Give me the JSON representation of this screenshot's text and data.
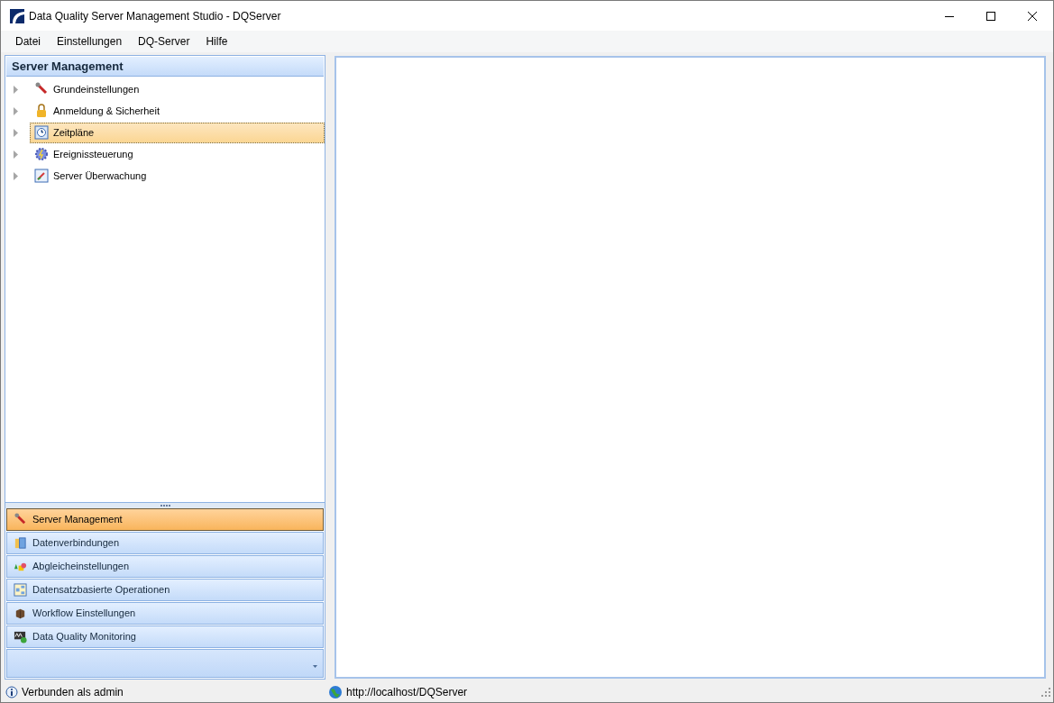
{
  "window": {
    "title": "Data Quality Server Management Studio - DQServer"
  },
  "menu": [
    "Datei",
    "Einstellungen",
    "DQ-Server",
    "Hilfe"
  ],
  "panel": {
    "title": "Server Management",
    "tree": [
      {
        "label": "Grundeinstellungen",
        "expanded": false,
        "selected": false
      },
      {
        "label": "Anmeldung & Sicherheit",
        "expanded": false,
        "selected": false
      },
      {
        "label": "Zeitpläne",
        "expanded": false,
        "selected": true
      },
      {
        "label": "Ereignissteuerung",
        "expanded": false,
        "selected": false
      },
      {
        "label": "Server Überwachung",
        "expanded": false,
        "selected": false
      }
    ]
  },
  "nav": [
    {
      "label": "Server Management",
      "selected": true
    },
    {
      "label": "Datenverbindungen",
      "selected": false
    },
    {
      "label": "Abgleicheinstellungen",
      "selected": false
    },
    {
      "label": "Datensatzbasierte Operationen",
      "selected": false
    },
    {
      "label": "Workflow Einstellungen",
      "selected": false
    },
    {
      "label": "Data Quality Monitoring",
      "selected": false
    }
  ],
  "status_bar": {
    "connection": "Verbunden als admin",
    "url": "http://localhost/DQServer"
  }
}
